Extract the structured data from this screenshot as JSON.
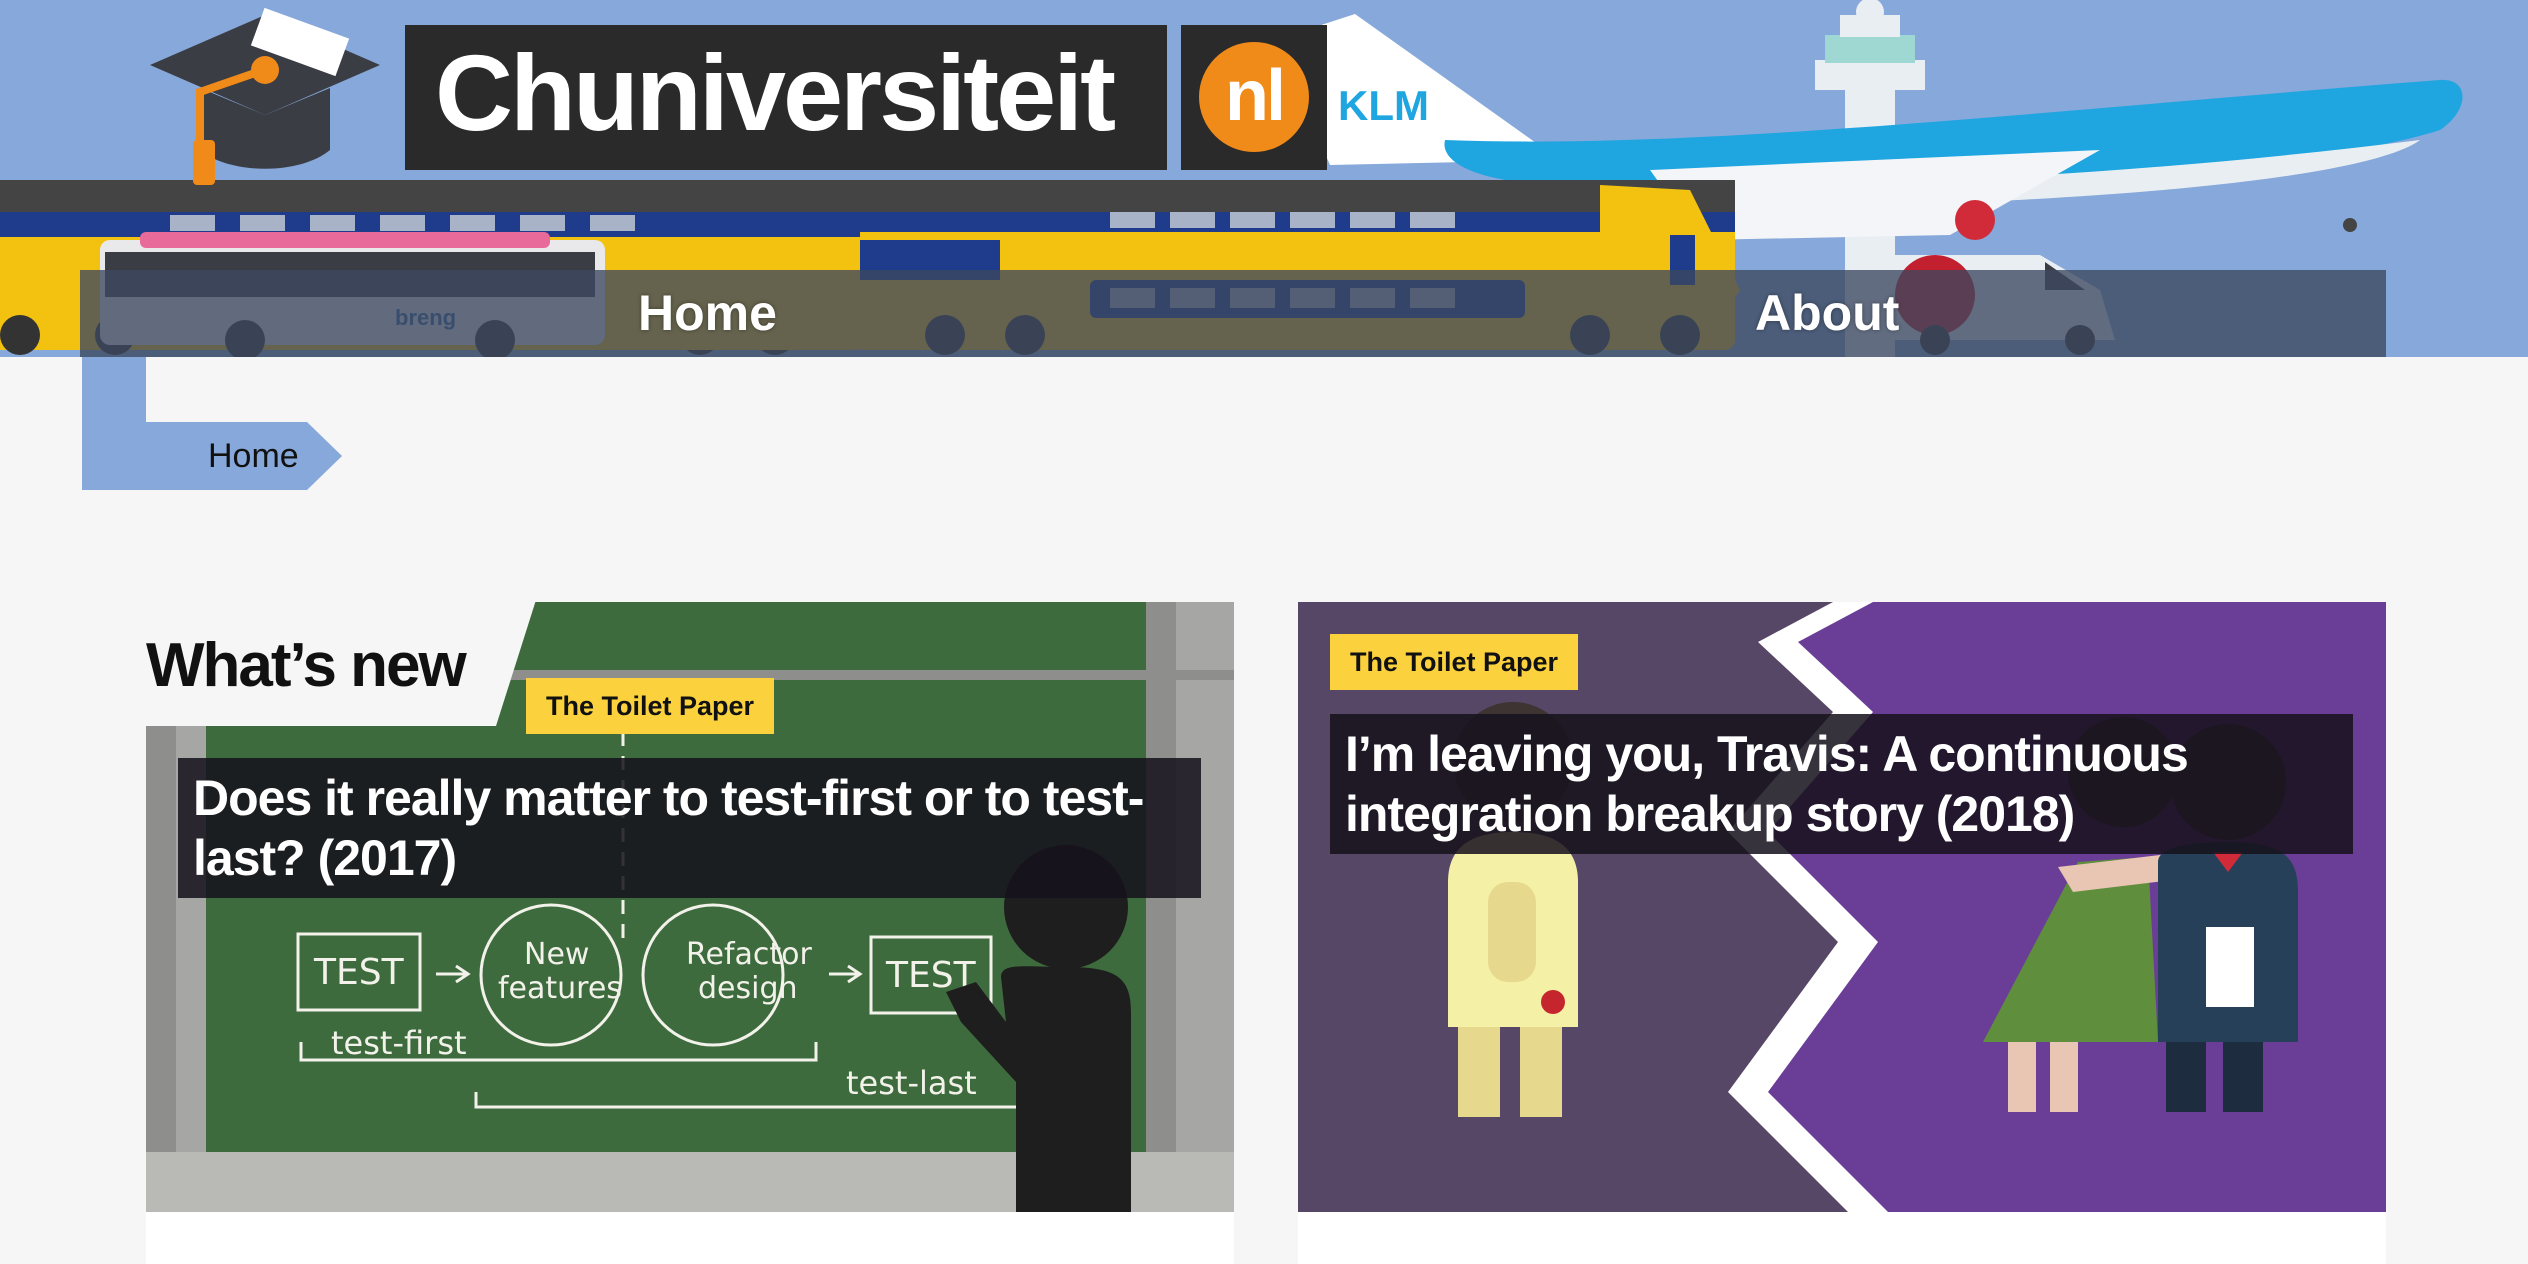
{
  "header": {
    "site_title": "Chuniversiteit",
    "badge": "nl",
    "nav": [
      {
        "label": "Home"
      },
      {
        "label": "About"
      }
    ]
  },
  "breadcrumb": {
    "current": "Home"
  },
  "section": {
    "title": "What’s new"
  },
  "articles": [
    {
      "category": "The Toilet Paper",
      "title": "Does it really matter to test-first or to test-last? (2017)"
    },
    {
      "category": "The Toilet Paper",
      "title": "I’m leaving you, Travis: A continuous integration breakup story (2018)"
    }
  ],
  "colors": {
    "sky": "#86a8da",
    "accent_yellow": "#fbd23d",
    "chalkboard": "#3e6b3d",
    "purple_dark": "#574767",
    "purple_light": "#6a3e96"
  }
}
